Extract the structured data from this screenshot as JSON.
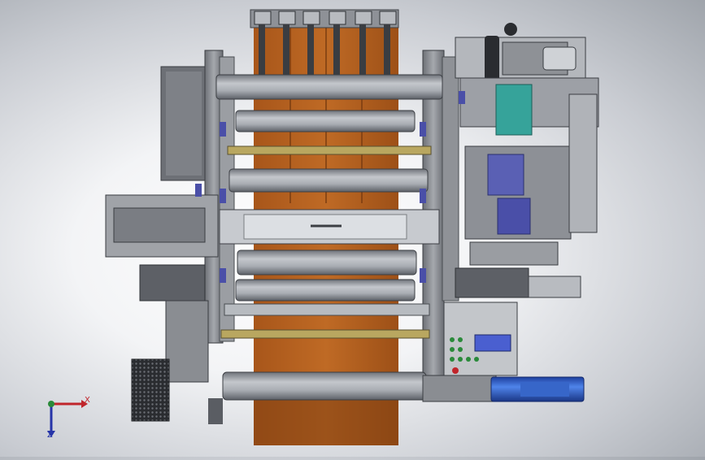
{
  "scene": {
    "view": "top",
    "colors": {
      "frame": "#8d8f95",
      "frame_dark": "#4e5258",
      "roller": "#a8acb2",
      "web": "#b5601d",
      "web_dark": "#8c4513",
      "bolt_blue": "#4a4fa8",
      "motor_teal": "#36a39a",
      "cylinder_blue": "#2a5ad0",
      "panel": "#c9ccd0",
      "button_green": "#2a8a3a",
      "display": "#4a5fd0"
    }
  },
  "triad": {
    "x_label": "X",
    "y_label": "Z",
    "x_color": "#c0252b",
    "y_color": "#2634a8"
  }
}
